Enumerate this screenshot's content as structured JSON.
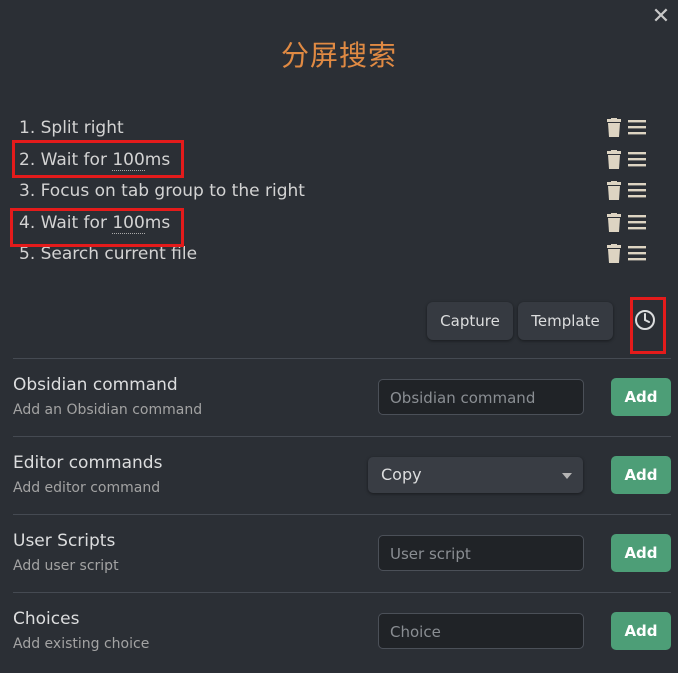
{
  "modal": {
    "title": "分屏搜索",
    "close_icon": "close-icon"
  },
  "steps": [
    {
      "label": "1. Split right"
    },
    {
      "prefix": "2. Wait for ",
      "value": "100",
      "unit": "ms"
    },
    {
      "label": "3. Focus on tab group to the right"
    },
    {
      "prefix": "4. Wait for ",
      "value": "100",
      "unit": "ms"
    },
    {
      "label": "5. Search current file"
    }
  ],
  "step_actions": {
    "delete_icon": "trash-icon",
    "drag_icon": "menu-icon"
  },
  "toolbar": {
    "capture_label": "Capture",
    "template_label": "Template",
    "wait_icon": "clock-icon"
  },
  "sections": {
    "obsidian": {
      "title": "Obsidian command",
      "desc": "Add an Obsidian command",
      "placeholder": "Obsidian command",
      "add": "Add"
    },
    "editor": {
      "title": "Editor commands",
      "desc": "Add editor command",
      "selected": "Copy",
      "add": "Add"
    },
    "user_scripts": {
      "title": "User Scripts",
      "desc": "Add user script",
      "placeholder": "User script",
      "add": "Add"
    },
    "choices": {
      "title": "Choices",
      "desc": "Add existing choice",
      "placeholder": "Choice",
      "add": "Add"
    }
  },
  "colors": {
    "title": "#e08a43",
    "add_button": "#4d9e77",
    "highlight": "#e41b1b",
    "background": "#2b2f35"
  }
}
